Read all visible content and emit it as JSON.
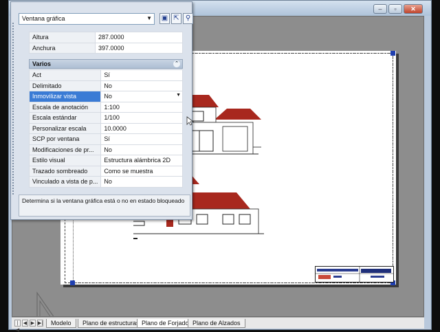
{
  "window": {
    "minimize_glyph": "–",
    "maximize_glyph": "▫",
    "close_glyph": "✕"
  },
  "palette": {
    "object_selector": "Ventana gráfica",
    "toolbar_icons": [
      "quick-select-icon",
      "select-objects-icon",
      "toggle-pickadd-icon"
    ],
    "geometry": [
      {
        "name": "Altura",
        "value": "287.0000"
      },
      {
        "name": "Anchura",
        "value": "397.0000"
      }
    ],
    "category": "Varios",
    "misc": [
      {
        "name": "Act",
        "value": "Sí"
      },
      {
        "name": "Delimitado",
        "value": "No"
      },
      {
        "name": "Inmovilizar vista",
        "value": "No"
      },
      {
        "name": "Escala de anotación",
        "value": "1:100"
      },
      {
        "name": "Escala estándar",
        "value": "1/100"
      },
      {
        "name": "Personalizar escala",
        "value": "10.0000"
      },
      {
        "name": "SCP por ventana",
        "value": "Sí"
      },
      {
        "name": "Modificaciones de pr...",
        "value": "No"
      },
      {
        "name": "Estilo visual",
        "value": "Estructura alámbrica 2D"
      },
      {
        "name": "Trazado sombreado",
        "value": "Como se muestra"
      },
      {
        "name": "Vinculado a vista de p...",
        "value": "No"
      }
    ],
    "selected_property": "Inmovilizar vista",
    "description": "Determina si la ventana gráfica está o no en estado bloqueado"
  },
  "tabs": {
    "nav": [
      "|◀",
      "◀",
      "▶",
      "▶|"
    ],
    "items": [
      "Modelo",
      "Plano de estructuras",
      "Plano de Forjados",
      "Plano de Alzados"
    ],
    "active": "Plano de Forjados"
  },
  "colors": {
    "roof_red": "#a8281e",
    "selection_blue": "#3a7bd5",
    "grip_blue": "#1f3fb0",
    "layout_gray": "#8d8d8d"
  }
}
